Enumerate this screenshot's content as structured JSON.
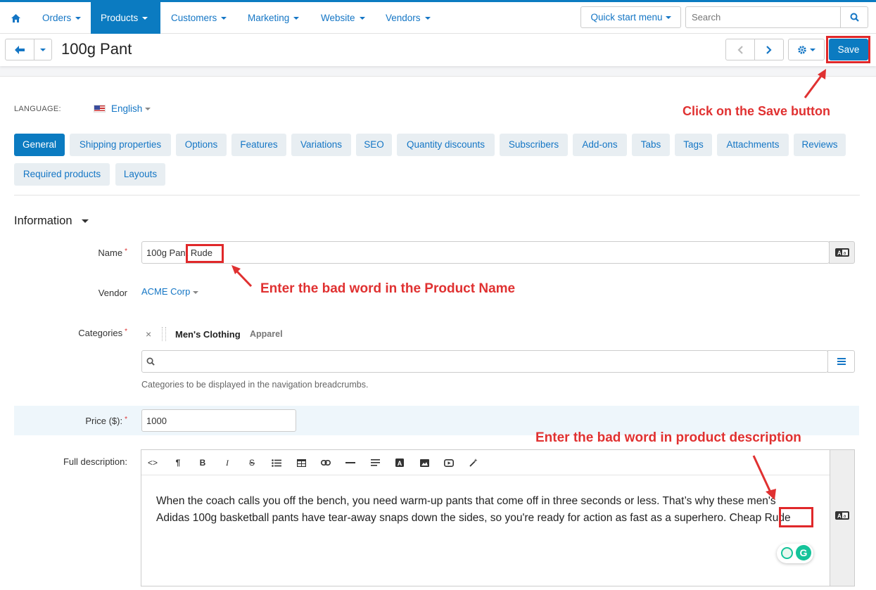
{
  "nav": {
    "items": [
      {
        "label": "Orders"
      },
      {
        "label": "Products"
      },
      {
        "label": "Customers"
      },
      {
        "label": "Marketing"
      },
      {
        "label": "Website"
      },
      {
        "label": "Vendors"
      }
    ],
    "quick_start": "Quick start menu",
    "search_placeholder": "Search"
  },
  "toolbar": {
    "title": "100g Pant",
    "save_label": "Save"
  },
  "language": {
    "label": "LANGUAGE:",
    "value": "English"
  },
  "tabs": [
    "General",
    "Shipping properties",
    "Options",
    "Features",
    "Variations",
    "SEO",
    "Quantity discounts",
    "Subscribers",
    "Add-ons",
    "Tabs",
    "Tags",
    "Attachments",
    "Reviews",
    "Required products",
    "Layouts"
  ],
  "form": {
    "section": "Information",
    "name_label": "Name",
    "name_value": "100g Pant",
    "name_bad_word": "Rude",
    "vendor_label": "Vendor",
    "vendor_value": "ACME Corp",
    "categories_label": "Categories",
    "category_main": "Men's Clothing",
    "category_sub": "Apparel",
    "categories_hint": "Categories to be displayed in the navigation breadcrumbs.",
    "price_label": "Price ($):",
    "price_value": "1000",
    "description_label": "Full description:",
    "description_line1": "When the coach calls you off the bench, you need warm-up pants that come off in three seconds or less. That’s why these men's",
    "description_line2": "Adidas 100g basketball pants have tear-away snaps down the sides, so you're ready for action as fast as a superhero. Cheap",
    "description_bad_word": "Rude"
  },
  "annotations": {
    "save": "Click on the Save button",
    "name": "Enter the bad word in the Product Name",
    "description": "Enter the bad word in product description"
  },
  "colors": {
    "primary": "#0b7bc1",
    "link": "#1476c5",
    "annotation": "#e03131"
  }
}
